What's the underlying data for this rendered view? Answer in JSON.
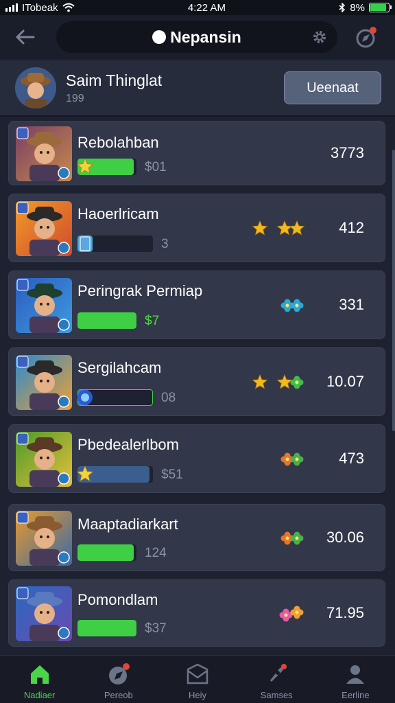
{
  "status_bar": {
    "carrier": "ITobeak",
    "time": "4:22 AM",
    "battery": "8%"
  },
  "top_nav": {
    "title": "Nepansin"
  },
  "profile": {
    "name": "Saim Thinglat",
    "subtitle": "199",
    "action_label": "Ueenaat"
  },
  "rows": [
    {
      "name": "Rebolahban",
      "sub": "$01",
      "value": "3773",
      "progress": 0.95,
      "bar_color": "#3fcf44",
      "sub_color": "#8a93a8",
      "badge": "star",
      "rating": "none"
    },
    {
      "name": "Haoerlricam",
      "sub": "3",
      "value": "412",
      "progress": 0.2,
      "bar_color": "#4aa3d8",
      "sub_color": "#8a93a8",
      "badge": "card",
      "rating": "stars3"
    },
    {
      "name": "Peringrak Permiap",
      "sub": "$7",
      "value": "331",
      "progress": 1.0,
      "bar_color": "#3fcf44",
      "sub_color": "#52d743",
      "badge": "none",
      "rating": "clovers"
    },
    {
      "name": "Sergilahcam",
      "sub": "08",
      "value": "10.07",
      "progress": 0.15,
      "bar_color": "#3d7fd6",
      "sub_color": "#8a93a8",
      "badge": "gem",
      "rating": "stars2clover"
    },
    {
      "name": "Pbedealerlbom",
      "sub": "$51",
      "value": "473",
      "progress": 0.95,
      "bar_color": "#3a5f8f",
      "sub_color": "#8a93a8",
      "badge": "star",
      "rating": "flowers"
    },
    {
      "name": "Maaptadiarkart",
      "sub": "124",
      "value": "30.06",
      "progress": 0.95,
      "bar_color": "#3fcf44",
      "sub_color": "#8a93a8",
      "badge": "none",
      "rating": "flowers"
    },
    {
      "name": "Pomondlam",
      "sub": "$37",
      "value": "71.95",
      "progress": 1.0,
      "bar_color": "#3fcf44",
      "sub_color": "#8a93a8",
      "badge": "none",
      "rating": "pinkflowers"
    }
  ],
  "bottom_nav": [
    {
      "label": "Nadiaer",
      "icon": "home-icon",
      "active": true
    },
    {
      "label": "Pereob",
      "icon": "compass-icon",
      "active": false
    },
    {
      "label": "Heiy",
      "icon": "inbox-icon",
      "active": false
    },
    {
      "label": "Samses",
      "icon": "rocket-icon",
      "active": false
    },
    {
      "label": "Eerline",
      "icon": "person-icon",
      "active": false
    }
  ],
  "colors": {
    "accent_green": "#3fcf44",
    "row_bg": "#323749",
    "page_bg": "#1d2130"
  }
}
